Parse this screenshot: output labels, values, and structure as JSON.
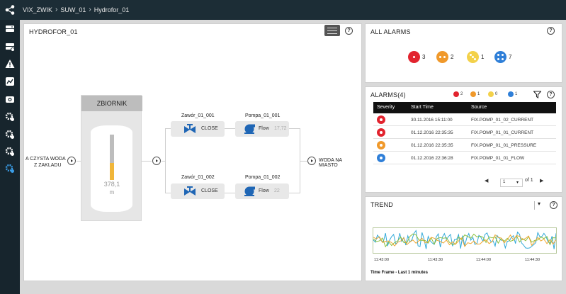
{
  "breadcrumb": [
    "VIX_ZWIK",
    "SUW_01",
    "Hydrofor_01"
  ],
  "sidebar": {
    "icons": [
      "database-icon",
      "database-list-icon",
      "warning-icon",
      "chart-icon",
      "camera-icon",
      "gear-icon",
      "gear-icon",
      "gear-icon",
      "gears-icon"
    ],
    "active_index": 8
  },
  "hydrofor": {
    "title": "HYDROFOR_01",
    "help": "?",
    "tank": {
      "title": "ZBIORNIK",
      "value": "378,1",
      "unit": "m",
      "level": 0.38
    },
    "inlet_label_1": "A CZYSTA WODA",
    "inlet_label_2": "Z ZAKLADU",
    "outlet_label": "WODA NA MIASTO",
    "valves": [
      {
        "name": "Zawór_01_001",
        "state": "CLOSE"
      },
      {
        "name": "Zawór_01_002",
        "state": "CLOSE"
      }
    ],
    "pumps": [
      {
        "name": "Pompa_01_001",
        "label": "Flow",
        "value": "17,72"
      },
      {
        "name": "Pompa_01_002",
        "label": "Flow",
        "value": "22"
      }
    ]
  },
  "all_alarms": {
    "title": "ALL ALARMS",
    "help": "?",
    "summary": [
      {
        "count": "3",
        "color": "#e2232e"
      },
      {
        "count": "2",
        "color": "#f0992b"
      },
      {
        "count": "1",
        "color": "#f3d14a"
      },
      {
        "count": "7",
        "color": "#2f7fd8"
      }
    ]
  },
  "alarms": {
    "title": "ALARMS(4)",
    "help": "?",
    "mini_counts": [
      {
        "count": "2",
        "color": "#e2232e"
      },
      {
        "count": "1",
        "color": "#f0992b"
      },
      {
        "count": "0",
        "color": "#f3d14a"
      },
      {
        "count": "1",
        "color": "#2f7fd8"
      }
    ],
    "columns": [
      "Severity",
      "Start Time",
      "Source"
    ],
    "rows": [
      {
        "color": "#e2232e",
        "time": "30.11.2016 15:11:00",
        "source": "FIX.POMP_01_02_CURRENT"
      },
      {
        "color": "#e2232e",
        "time": "01.12.2016 22:35:35",
        "source": "FIX.POMP_01_01_CURRENT"
      },
      {
        "color": "#f0992b",
        "time": "01.12.2016 22:35:35",
        "source": "FIX.POMP_01_01_PRESSURE"
      },
      {
        "color": "#2f7fd8",
        "time": "01.12.2016 22:36:28",
        "source": "FIX.POMP_01_01_FLOW"
      }
    ],
    "pager": {
      "page": "1",
      "of_label": "of 1"
    }
  },
  "trend": {
    "title": "TREND",
    "help": "?",
    "ticks": [
      "11:43:00",
      "11:43:30",
      "11:44:00",
      "11:44:30"
    ],
    "timeframe": "Time Frame - Last 1 minutes",
    "series_colors": [
      "#2fa8d8",
      "#8bbf3a",
      "#f0a52b"
    ]
  }
}
